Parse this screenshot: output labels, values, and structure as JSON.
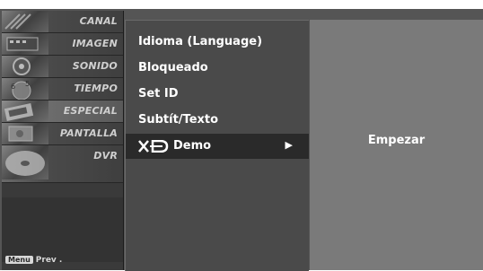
{
  "categories": [
    {
      "label": "CANAL",
      "icon": "antenna-icon"
    },
    {
      "label": "IMAGEN",
      "icon": "film-icon"
    },
    {
      "label": "SONIDO",
      "icon": "speaker-icon"
    },
    {
      "label": "TIEMPO",
      "icon": "clock-icon"
    },
    {
      "label": "ESPECIAL",
      "icon": "special-icon"
    },
    {
      "label": "PANTALLA",
      "icon": "screen-icon"
    },
    {
      "label": "DVR",
      "icon": "disc-icon"
    }
  ],
  "selected_category": "ESPECIAL",
  "footer": {
    "key": "Menu",
    "text": "Prev ."
  },
  "options": [
    {
      "label": "Idioma (Language)"
    },
    {
      "label": "Bloqueado"
    },
    {
      "label": "Set ID"
    },
    {
      "label": "Subtít/Texto"
    },
    {
      "label": "Demo",
      "logo": "XD",
      "arrow": "▶",
      "selected": true
    }
  ],
  "submenu": {
    "item": "Empezar"
  }
}
